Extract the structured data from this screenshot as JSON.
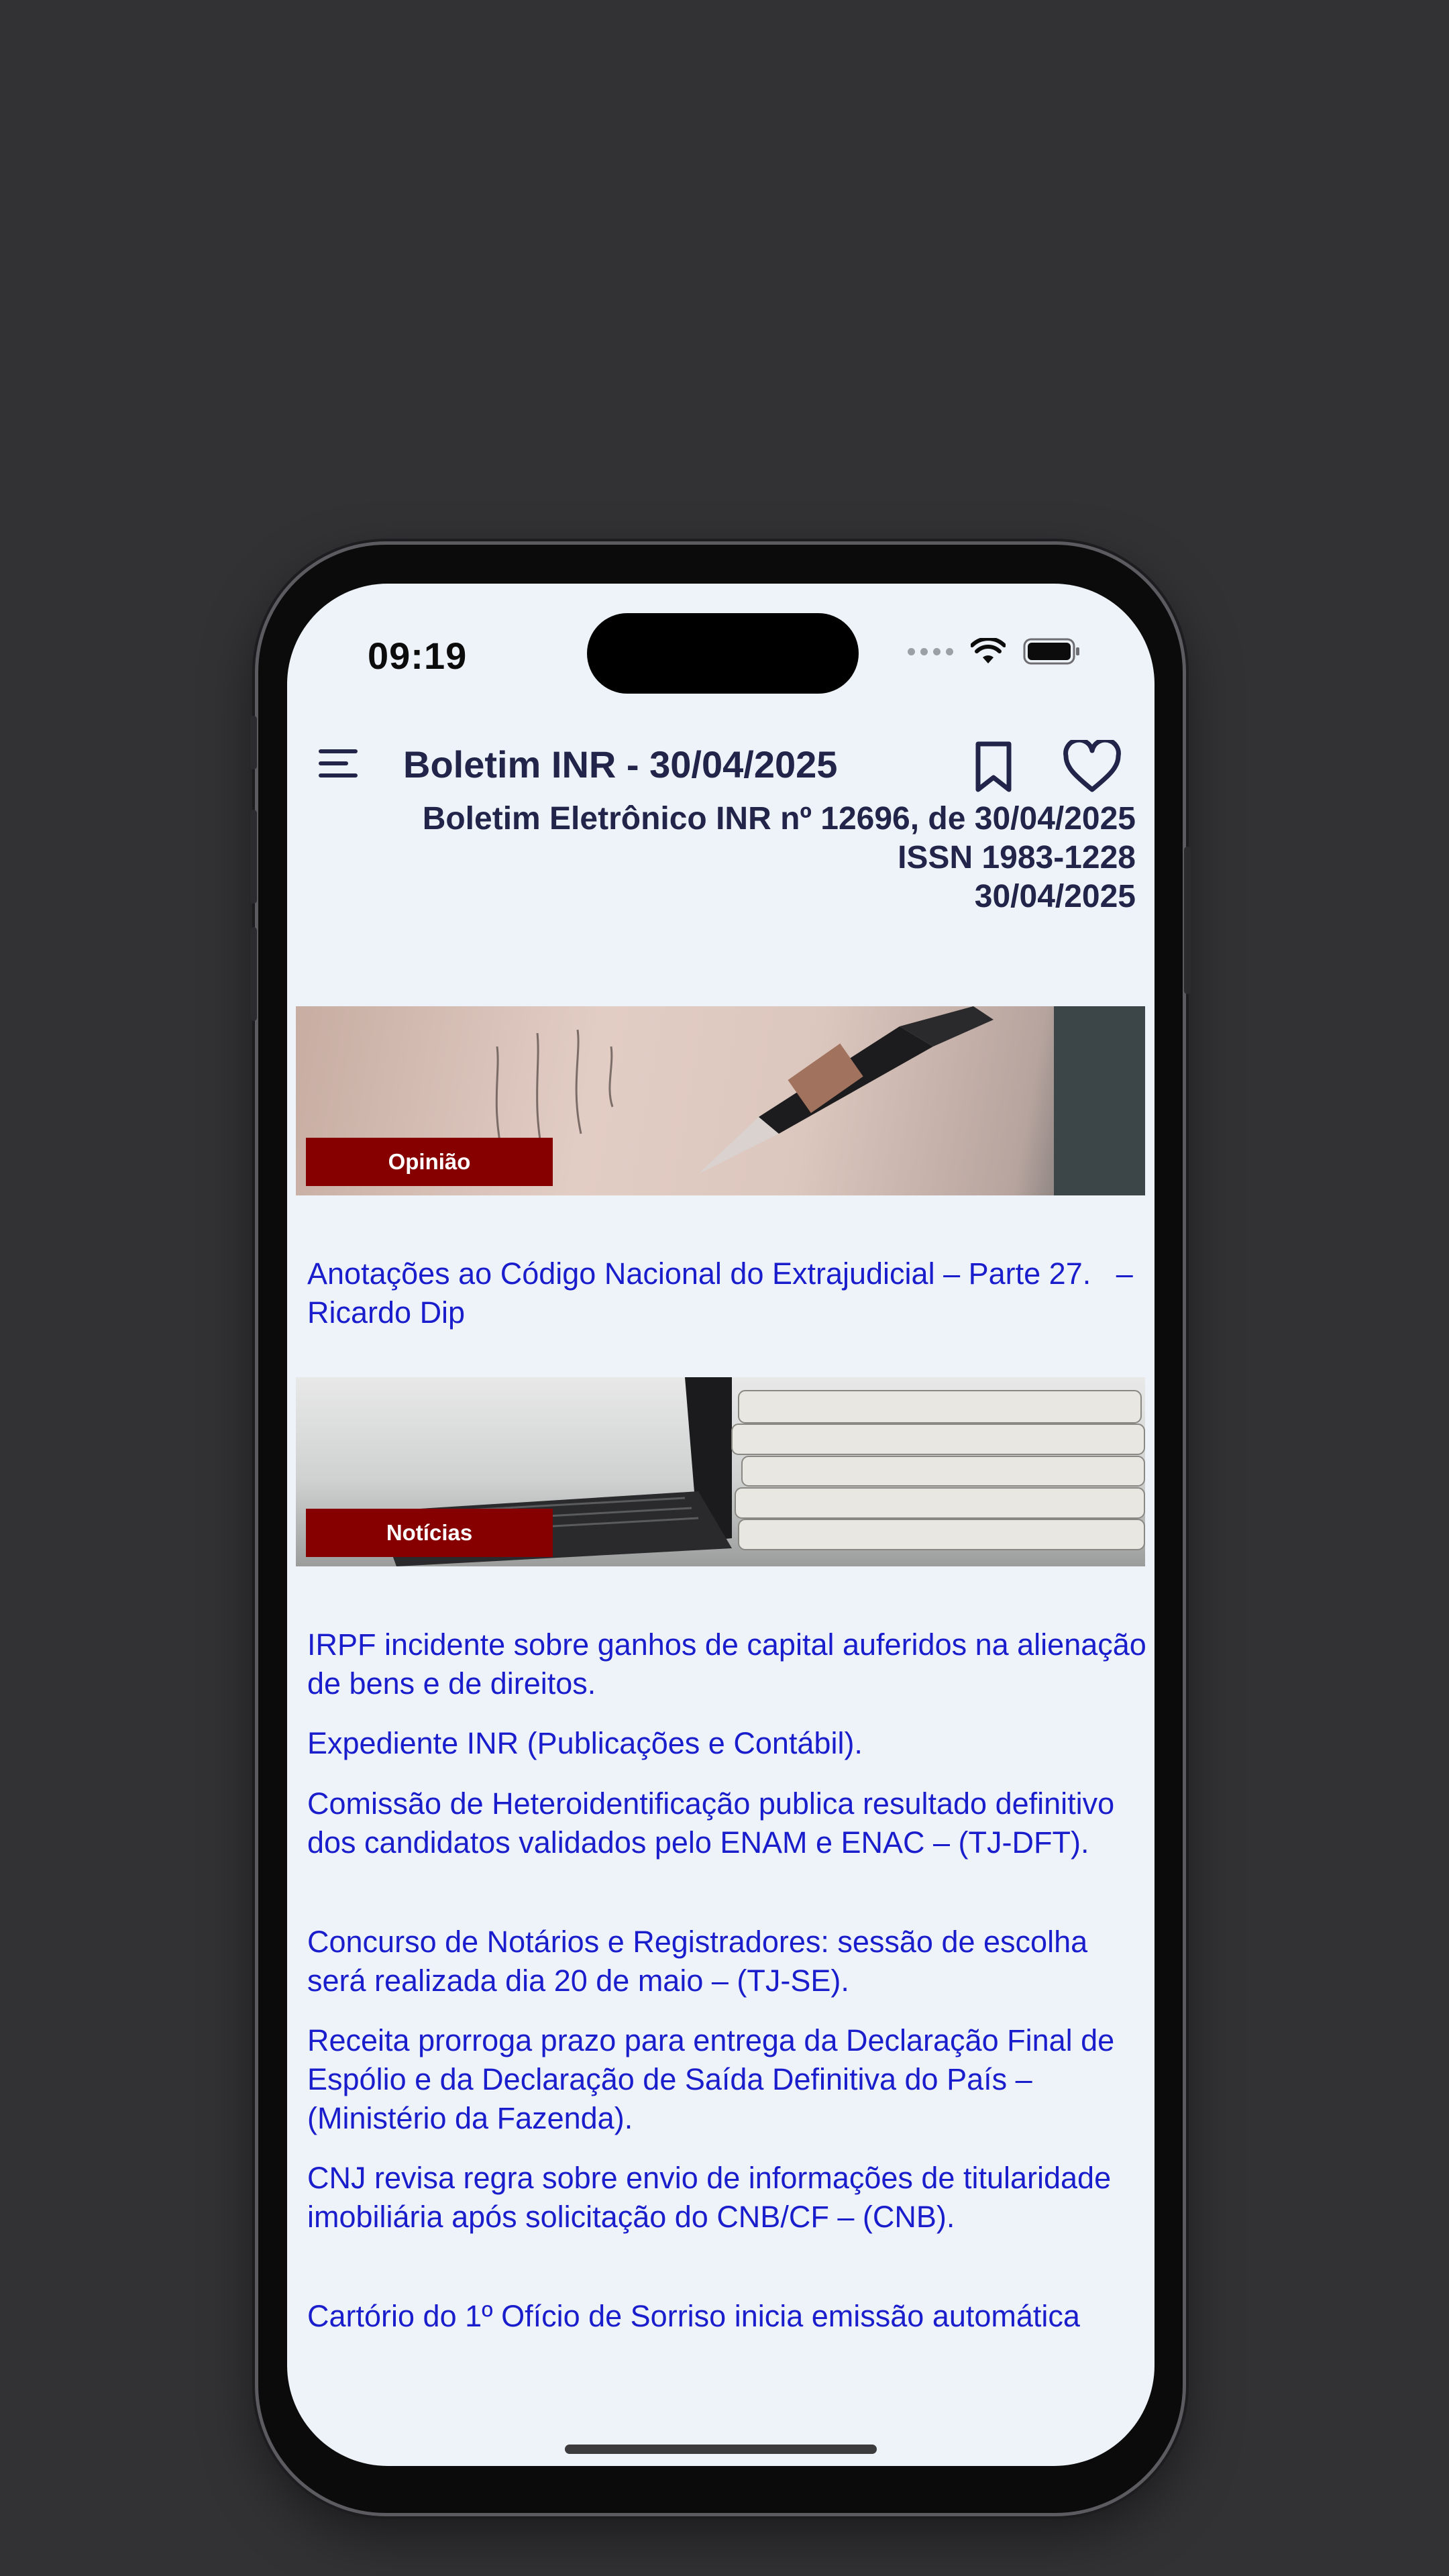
{
  "status_bar": {
    "time": "09:19"
  },
  "header": {
    "title": "Boletim INR - 30/04/2025",
    "menu_icon": "hamburger-menu-icon",
    "bookmark_icon": "bookmark-icon",
    "favorite_icon": "heart-icon"
  },
  "bulletin": {
    "line1": "Boletim Eletrônico INR nº 12696, de 30/04/2025",
    "line2": "ISSN 1983-1228",
    "line3": "30/04/2025"
  },
  "sections": {
    "opiniao": {
      "label": "Opinião",
      "articles": [
        "Anotações ao Código Nacional do Extrajudicial – Parte 27.   – Ricardo Dip"
      ]
    },
    "noticias": {
      "label": "Notícias",
      "articles": [
        "IRPF incidente sobre ganhos de capital auferidos na alienação de bens e de direitos.",
        "Expediente INR (Publicações e Contábil).",
        "Comissão de Heteroidentificação publica resultado definitivo dos candidatos validados pelo ENAM e ENAC – (TJ-DFT).",
        "Concurso de Notários e Registradores: sessão de escolha será realizada dia 20 de maio – (TJ-SE).",
        "Receita prorroga prazo para entrega da Declaração Final de Espólio e da Declaração de Saída Definitiva do País – (Ministério da Fazenda).",
        "CNJ revisa regra sobre envio de informações de titularidade imobiliária após solicitação do CNB/CF – (CNB).",
        "Cartório do 1º Ofício de Sorriso inicia emissão automática"
      ]
    }
  },
  "colors": {
    "background": "#323234",
    "screen": "#edf3f8",
    "header_text": "#23244a",
    "link": "#1a1dcc",
    "section_label": "#870000"
  }
}
